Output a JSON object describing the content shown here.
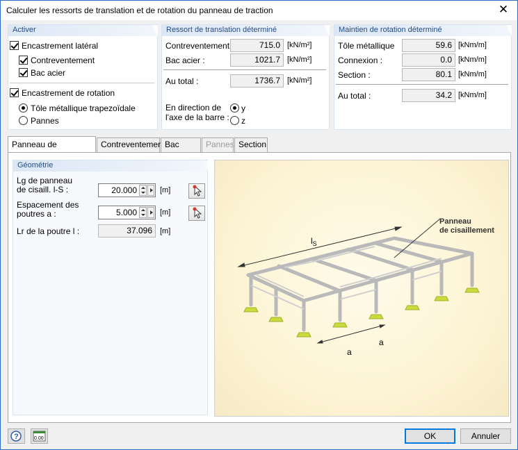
{
  "window": {
    "title": "Calculer les ressorts de translation et de rotation du panneau de traction",
    "close_glyph": "✕"
  },
  "activer": {
    "header": "Activer",
    "lateral_label": "Encastrement latéral",
    "contreventement_label": "Contreventement",
    "bac_acier_label": "Bac acier",
    "rotation_label": "Encastrement de rotation",
    "tole_label": "Tôle métallique trapezoïdale",
    "pannes_label": "Pannes"
  },
  "translation": {
    "header": "Ressort de translation déterminé",
    "rows": [
      {
        "label": "Contreventement :",
        "value": "715.0",
        "unit": "[kN/m²]"
      },
      {
        "label": "Bac acier :",
        "value": "1021.7",
        "unit": "[kN/m²]"
      }
    ],
    "total": {
      "label": "Au total :",
      "value": "1736.7",
      "unit": "[kN/m²]"
    },
    "direction_label_1": "En direction de",
    "direction_label_2": "l'axe de la barre :",
    "dir_y": "y",
    "dir_z": "z"
  },
  "rotation": {
    "header": "Maintien de rotation déterminé",
    "rows": [
      {
        "label": "Tôle métallique",
        "value": "59.6",
        "unit": "[kNm/m]"
      },
      {
        "label": "Connexion :",
        "value": "0.0",
        "unit": "[kNm/m]"
      },
      {
        "label": "Section :",
        "value": "80.1",
        "unit": "[kNm/m]"
      }
    ],
    "total": {
      "label": "Au total :",
      "value": "34.2",
      "unit": "[kNm/m]"
    }
  },
  "tabs": [
    "Panneau de cisaillement",
    "Contreventement",
    "Bac acier",
    "Pannes",
    "Section"
  ],
  "geometrie": {
    "header": "Géométrie",
    "lg_label_1": "Lg de panneau",
    "lg_label_2": "de cisaill. l-S :",
    "lg_value": "20.000",
    "lg_unit": "[m]",
    "esp_label_1": "Espacement des",
    "esp_label_2": "poutres a :",
    "esp_value": "5.000",
    "esp_unit": "[m]",
    "lr_label": "Lr de la poutre l :",
    "lr_value": "37.096",
    "lr_unit": "[m]"
  },
  "figure": {
    "panneau_1": "Panneau",
    "panneau_2": "de cisaillement",
    "ls_main": "l",
    "ls_sub": "S",
    "a1": "a",
    "a2": "a"
  },
  "footer": {
    "ok": "OK",
    "cancel": "Annuler",
    "units_icon_text": "0.00"
  },
  "colors": {
    "accent": "#0078d7",
    "group_header_text": "#264d85",
    "support": "#c9dc3c"
  }
}
